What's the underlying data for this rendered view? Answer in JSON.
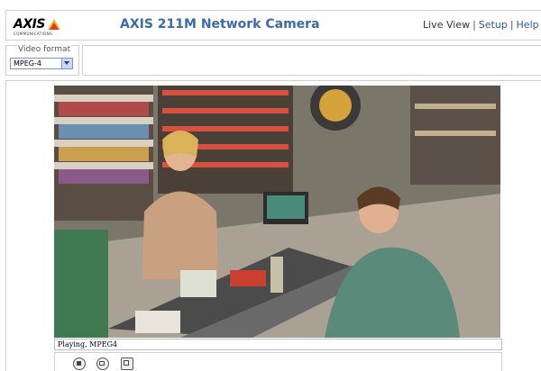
{
  "header": {
    "logo_text": "AXIS",
    "logo_sub": "COMMUNICATIONS",
    "title": "AXIS 211M Network Camera",
    "nav": {
      "live_view": "Live View",
      "separator": "|",
      "setup": "Setup",
      "help": "Help"
    }
  },
  "video_format": {
    "label": "Video format",
    "selected": "MPEG-4"
  },
  "player": {
    "status": "Playing, MPEG4",
    "buttons": [
      {
        "icon": "stop-icon"
      },
      {
        "icon": "snapshot-icon"
      },
      {
        "icon": "fullscreen-icon"
      }
    ]
  },
  "colors": {
    "title": "#3a6ab0",
    "link": "#2d57a8",
    "border": "#cfcfcf"
  }
}
